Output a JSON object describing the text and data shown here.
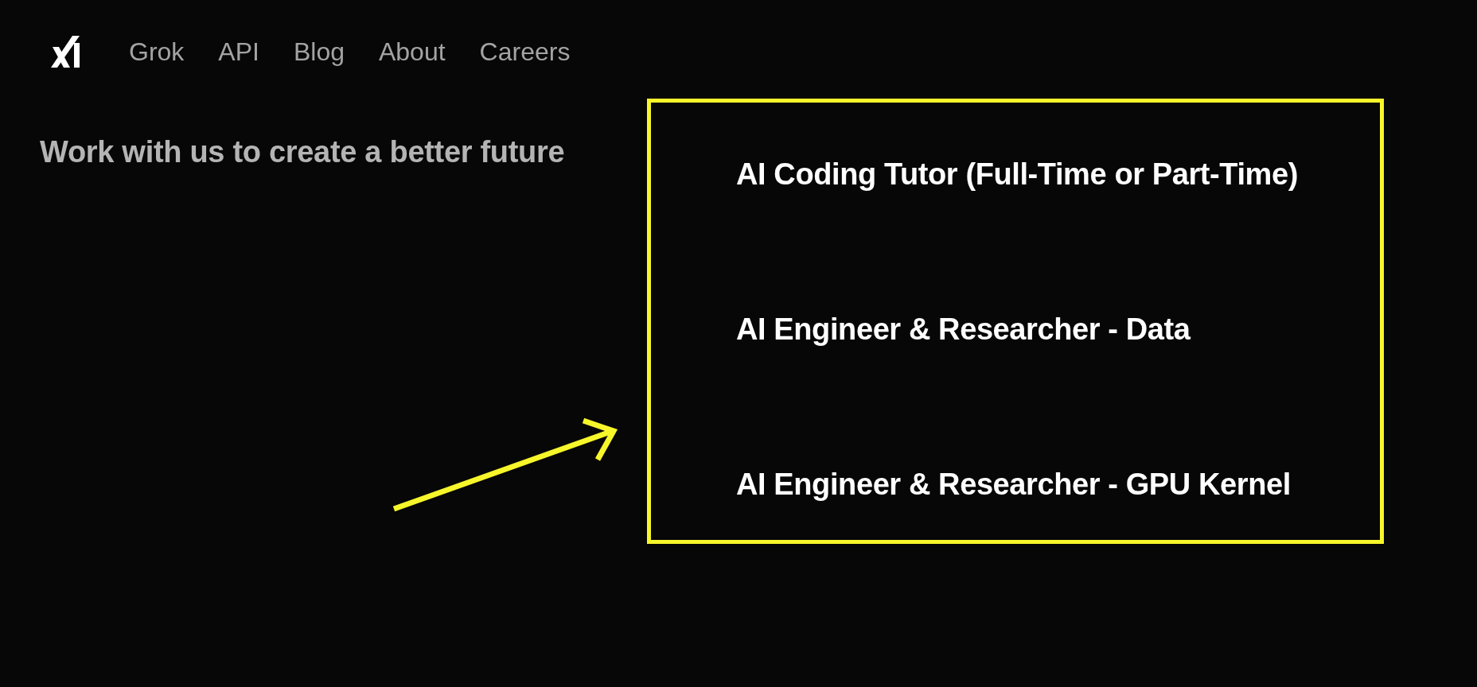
{
  "nav": {
    "items": [
      {
        "label": "Grok"
      },
      {
        "label": "API"
      },
      {
        "label": "Blog"
      },
      {
        "label": "About"
      },
      {
        "label": "Careers"
      }
    ]
  },
  "headline": "Work with us to create a better future",
  "jobs": [
    {
      "title": "AI Coding Tutor (Full-Time or Part-Time)"
    },
    {
      "title": "AI Engineer & Researcher - Data"
    },
    {
      "title": "AI Engineer & Researcher - GPU Kernel"
    }
  ]
}
